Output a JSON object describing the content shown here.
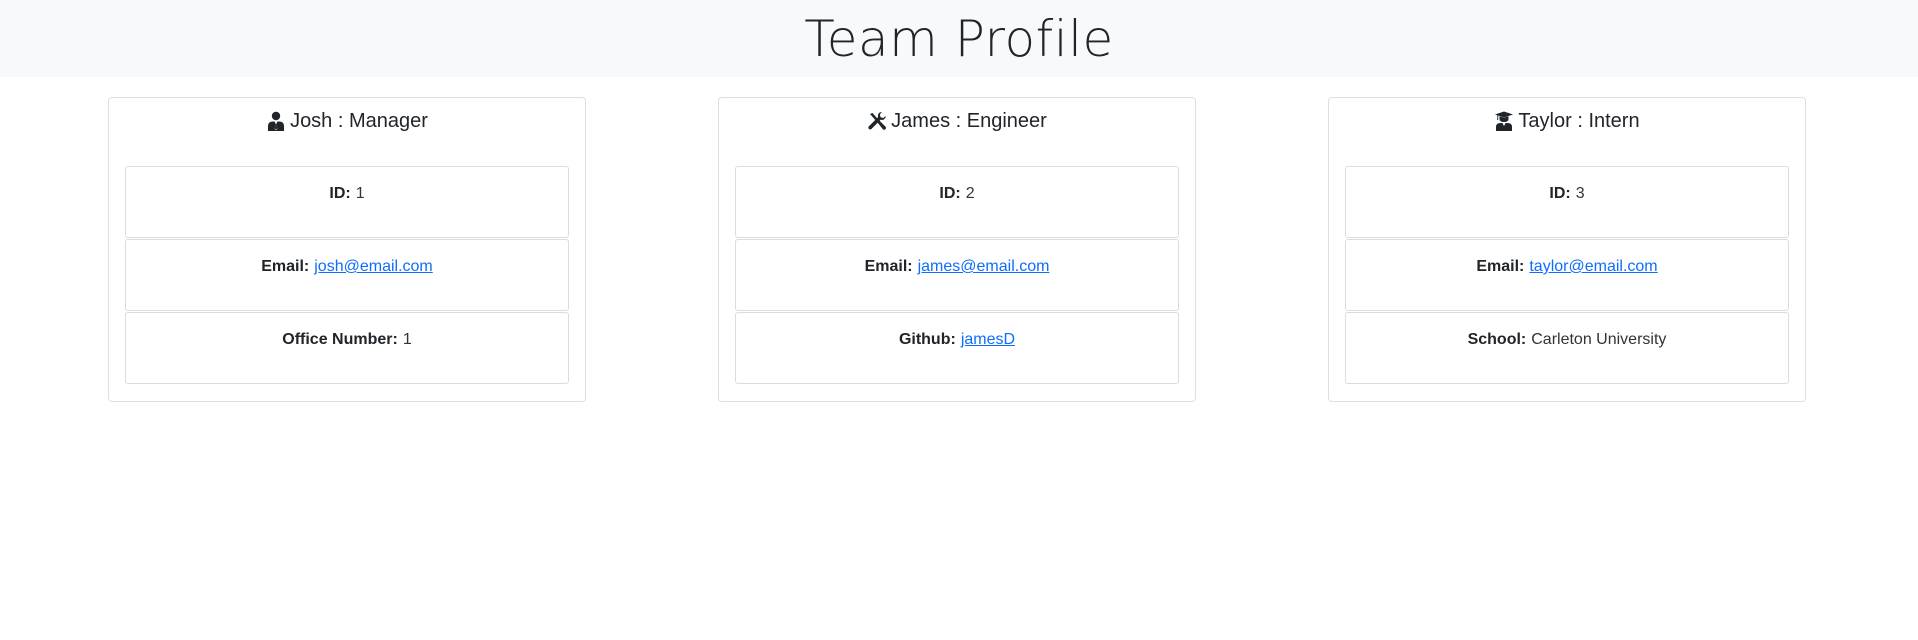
{
  "header": {
    "title": "Team Profile"
  },
  "cards": [
    {
      "name": "Josh",
      "role": "Manager",
      "icon": "manager-icon",
      "id_label": "ID:",
      "id_value": "1",
      "email_label": "Email:",
      "email_value": "josh@email.com",
      "extra_label": "Office Number:",
      "extra_value": "1"
    },
    {
      "name": "James",
      "role": "Engineer",
      "icon": "tools-icon",
      "id_label": "ID:",
      "id_value": "2",
      "email_label": "Email:",
      "email_value": "james@email.com",
      "extra_label": "Github:",
      "extra_value": "jamesD"
    },
    {
      "name": "Taylor",
      "role": "Intern",
      "icon": "graduate-icon",
      "id_label": "ID:",
      "id_value": "3",
      "email_label": "Email:",
      "email_value": "taylor@email.com",
      "extra_label": "School:",
      "extra_value": "Carleton University"
    }
  ],
  "colors": {
    "link": "#0d6efd",
    "header_bg": "#f8f9fa",
    "text": "#212529"
  }
}
